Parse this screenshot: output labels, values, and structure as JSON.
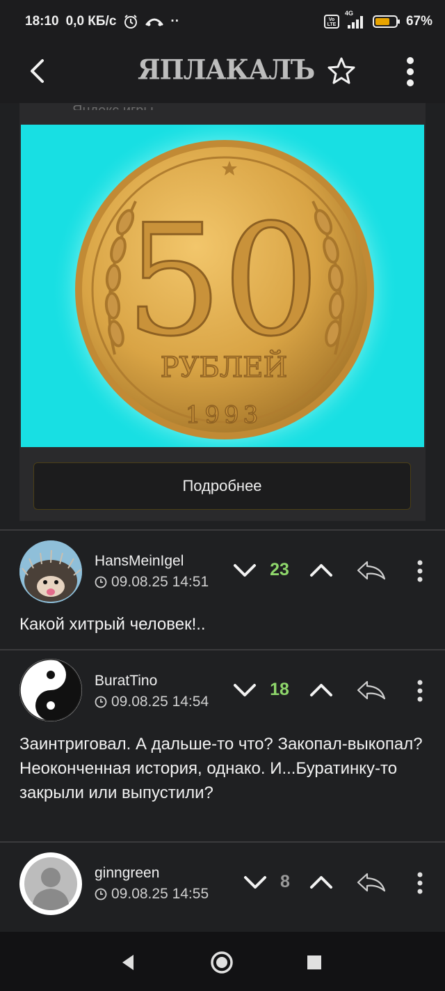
{
  "status": {
    "time": "18:10",
    "speed": "0,0 КБ/с",
    "dots": "··",
    "network": "4G",
    "battery": "67%"
  },
  "app": {
    "logo": "ЯПЛАКАЛЪ"
  },
  "ad": {
    "source": "Яндекс игры",
    "coin_value": "50",
    "coin_text": "РУБЛЕЙ",
    "coin_year": "1993",
    "button_label": "Подробнее"
  },
  "comments": [
    {
      "author": "HansMeinIgel",
      "date": "09.08.25 14:51",
      "score": "23",
      "score_color": "#8ed66b",
      "text": "Какой хитрый человек!.."
    },
    {
      "author": "BuratTino",
      "date": "09.08.25 14:54",
      "score": "18",
      "score_color": "#8ed66b",
      "text": "Заинтриговал. А дальше-то что? Закопал-выкопал? Неоконченная история, однако. И...Буратинку-то закрыли или выпустили?"
    },
    {
      "author": "ginngreen",
      "date": "09.08.25 14:55",
      "score": "8",
      "score_color": "#9a9a9a",
      "text": ""
    }
  ],
  "colors": {
    "background": "#1f2022",
    "ad_image_bg": "#18dfe3",
    "coin_gold": "#d9a445",
    "score_positive": "#8ed66b"
  }
}
